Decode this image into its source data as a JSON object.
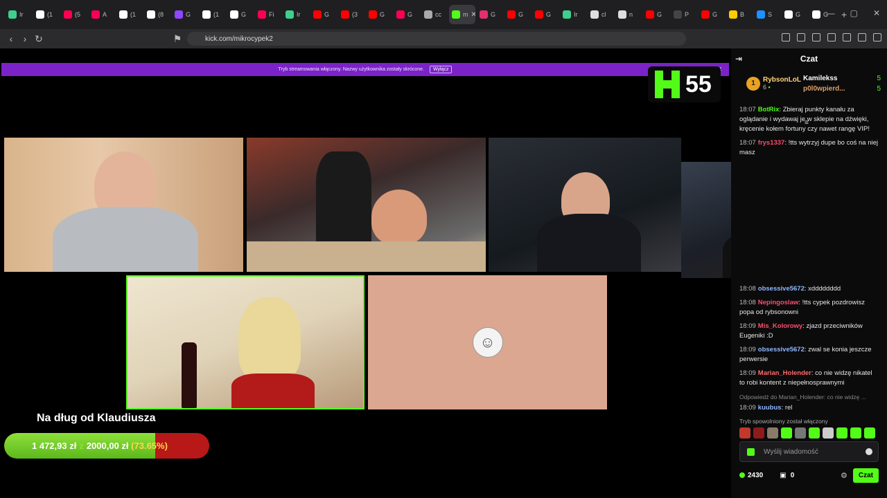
{
  "browser": {
    "tabs": [
      {
        "label": "Ir",
        "color": "#3ecf8e"
      },
      {
        "label": "(1",
        "color": "#ffffff"
      },
      {
        "label": "(5",
        "color": "#ff0050"
      },
      {
        "label": "A",
        "color": "#ff0050"
      },
      {
        "label": "(1",
        "color": "#ffffff"
      },
      {
        "label": "(8",
        "color": "#ffffff"
      },
      {
        "label": "G",
        "color": "#9146ff"
      },
      {
        "label": "(1",
        "color": "#ffffff"
      },
      {
        "label": "G",
        "color": "#ffffff"
      },
      {
        "label": "Fi",
        "color": "#ff0050"
      },
      {
        "label": "Ir",
        "color": "#3ecf8e"
      },
      {
        "label": "G",
        "color": "#ff0000"
      },
      {
        "label": "(3",
        "color": "#ff0000"
      },
      {
        "label": "G",
        "color": "#ff0000"
      },
      {
        "label": "G",
        "color": "#ff0050"
      },
      {
        "label": "cc",
        "color": "#aaaaaa"
      },
      {
        "label": "m",
        "color": "#53fc18",
        "active": true
      },
      {
        "label": "G",
        "color": "#e1306c"
      },
      {
        "label": "G",
        "color": "#ff0000"
      },
      {
        "label": "G",
        "color": "#ff0000"
      },
      {
        "label": "Ir",
        "color": "#3ecf8e"
      },
      {
        "label": "cl",
        "color": "#dddddd"
      },
      {
        "label": "n",
        "color": "#dddddd"
      },
      {
        "label": "G",
        "color": "#ff0000"
      },
      {
        "label": "P",
        "color": "#444444"
      },
      {
        "label": "G",
        "color": "#ff0000"
      },
      {
        "label": "B",
        "color": "#ffcc00"
      },
      {
        "label": "S",
        "color": "#1e90ff"
      },
      {
        "label": "G",
        "color": "#ffffff"
      },
      {
        "label": "G",
        "color": "#ffffff"
      }
    ],
    "url": "kick.com/mikrocypek2"
  },
  "banner": {
    "text": "Tryb streamowania włączony. Nazwy użytkownika zostały skrócone.",
    "button": "Wyłącz"
  },
  "logo_number": "55",
  "goal": {
    "title": "Na dług od Klaudiusza",
    "current": "1 472,93 zł",
    "z": "z",
    "target": "2000,00 zł",
    "percent_label": "(73.65%)",
    "percent": 73.65
  },
  "chat": {
    "title": "Czat",
    "leaderboard": [
      {
        "name": "RybsonLoL",
        "count": "6",
        "rank": "1"
      },
      {
        "name": "Kamilekss",
        "count": "5"
      },
      {
        "name": "p0l0wpierd...",
        "count": "5"
      }
    ],
    "messages_top": [
      {
        "time": "18:07",
        "user": "BotRix",
        "user_color": "#53fc18",
        "text": "Zbieraj punkty kanału za oglądanie i wydawaj je w sklepie na dźwięki, kręcenie kołem fortuny czy nawet rangę VIP!"
      },
      {
        "time": "18:07",
        "user": "frys1337",
        "user_color": "#ff4d6d",
        "text": "!tts wytrzyj dupe bo coś na niej masz"
      }
    ],
    "messages": [
      {
        "time": "18:08",
        "user": "obsessive5672",
        "user_color": "#8fb7ff",
        "text": "xdddddddd"
      },
      {
        "time": "18:08",
        "user": "Nepingoslaw",
        "user_color": "#ff4d6d",
        "text": "!tts cypek pozdrowisz popa od rybsonowni"
      },
      {
        "time": "18:09",
        "user": "Mis_Kolorowy",
        "user_color": "#ff4d6d",
        "text": "zjazd przeciwników Eugeniki :D"
      },
      {
        "time": "18:09",
        "user": "obsessive5672",
        "user_color": "#8fb7ff",
        "text": "zwal se konia jeszcze perwersie"
      },
      {
        "time": "18:09",
        "user": "Marian_Holender",
        "user_color": "#ff6b6b",
        "text": "co nie widzę nikatel to robi kontent z niepełnosprawnymi"
      }
    ],
    "reply_hint": "Odpowiedź do Marian_Holender: co nie widzę ...",
    "reply_msg": {
      "time": "18:09",
      "user": "kuubus",
      "user_color": "#8fb7ff",
      "text": "rel"
    },
    "slow_mode": "Tryb spowolniony został włączony",
    "input_placeholder": "Wyślij wiadomość",
    "points": "2430",
    "drops": "0",
    "send_label": "Czat"
  }
}
